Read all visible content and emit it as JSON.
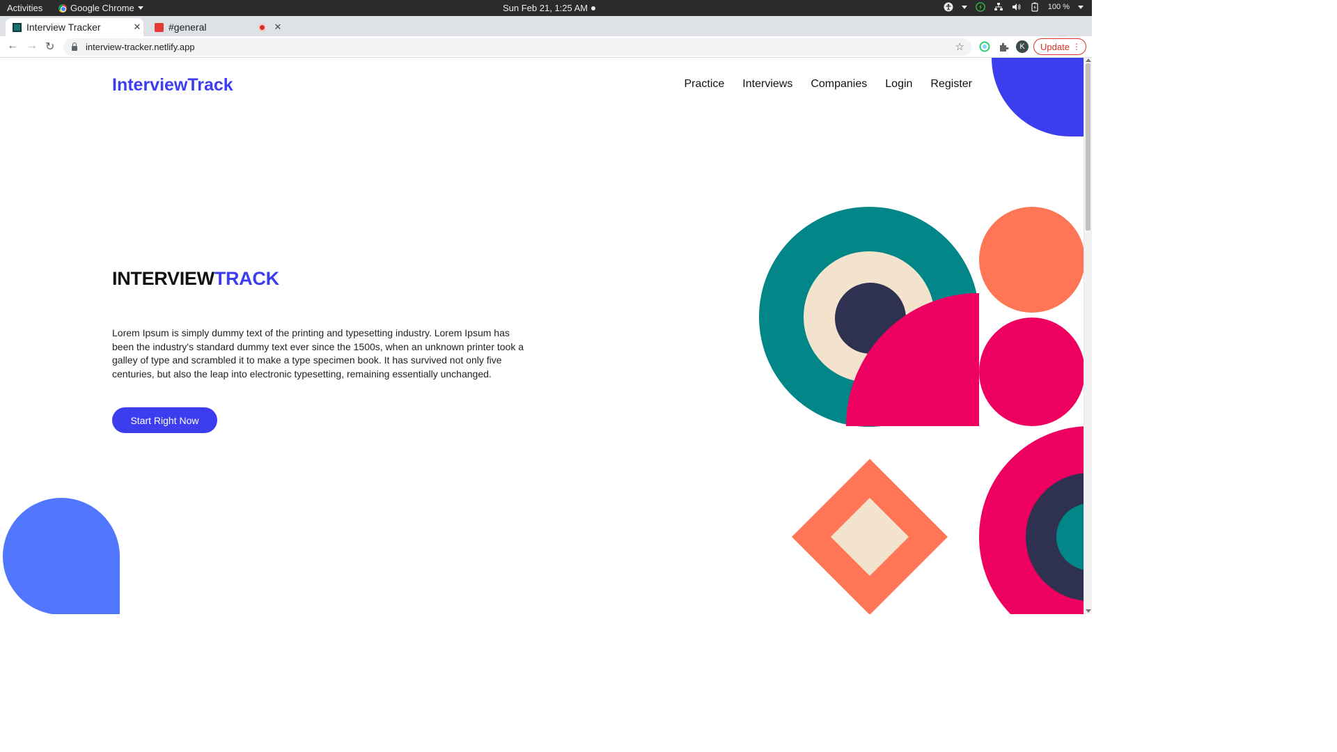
{
  "system_bar": {
    "activities": "Activities",
    "app_name": "Google Chrome",
    "clock": "Sun Feb 21,  1:25 AM",
    "battery": "100 %"
  },
  "browser": {
    "tabs": [
      {
        "title": "Interview Tracker",
        "active": true
      },
      {
        "title": "#general",
        "active": false
      }
    ],
    "url": "interview-tracker.netlify.app",
    "avatar_letter": "K",
    "update_label": "Update"
  },
  "page": {
    "brand": "InterviewTrack",
    "nav": [
      "Practice",
      "Interviews",
      "Companies",
      "Login",
      "Register"
    ],
    "hero": {
      "title_main": "INTERVIEW",
      "title_accent": "TRACK",
      "text": "Lorem Ipsum is simply dummy text of the printing and typesetting industry. Lorem Ipsum has been the industry's standard dummy text ever since the 1500s, when an unknown printer took a galley of type and scrambled it to make a type specimen book. It has survived not only five centuries, but also the leap into electronic typesetting, remaining essentially unchanged.",
      "cta": "Start Right Now"
    }
  },
  "colors": {
    "brand_blue": "#3d3df0",
    "teal": "#028688",
    "cream": "#f3e3cd",
    "navy": "#2e3150",
    "magenta": "#ee0060",
    "coral": "#ff7657",
    "light_blue": "#5277ff"
  }
}
